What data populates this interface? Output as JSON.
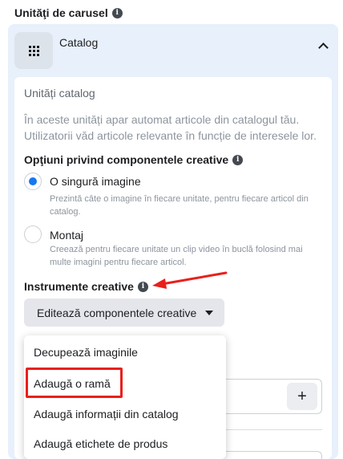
{
  "section": {
    "title": "Unităţi de carusel"
  },
  "catalog": {
    "title": "Catalog"
  },
  "card": {
    "title": "Unități catalog",
    "description": "În aceste unități apar automat articole din catalogul tău. Utilizatorii văd articole relevante în funcție de interesele lor."
  },
  "options": {
    "title": "Opţiuni privind componentele creative",
    "single": {
      "label": "O singură imagine",
      "help": "Prezintă câte o imagine în fiecare unitate, pentru fiecare articol din catalog.",
      "checked": true
    },
    "montage": {
      "label": "Montaj",
      "help": "Creează pentru fiecare unitate un clip video în buclă folosind mai multe imagini pentru fiecare articol.",
      "checked": false
    }
  },
  "tools": {
    "title": "Instrumente creative",
    "edit_button": "Editează componentele creative"
  },
  "dropdown": {
    "items": [
      "Decupează imaginile",
      "Adaugă o ramă",
      "Adaugă informații din catalog",
      "Adaugă etichete de produs"
    ]
  },
  "colors": {
    "accent": "#1877f2",
    "annotation": "#e8201c",
    "panel": "#e7f0fb"
  },
  "icons": [
    "info-icon",
    "grid-icon",
    "chevron-up-icon",
    "caret-down-icon",
    "plus-icon",
    "red-arrow-annotation"
  ]
}
